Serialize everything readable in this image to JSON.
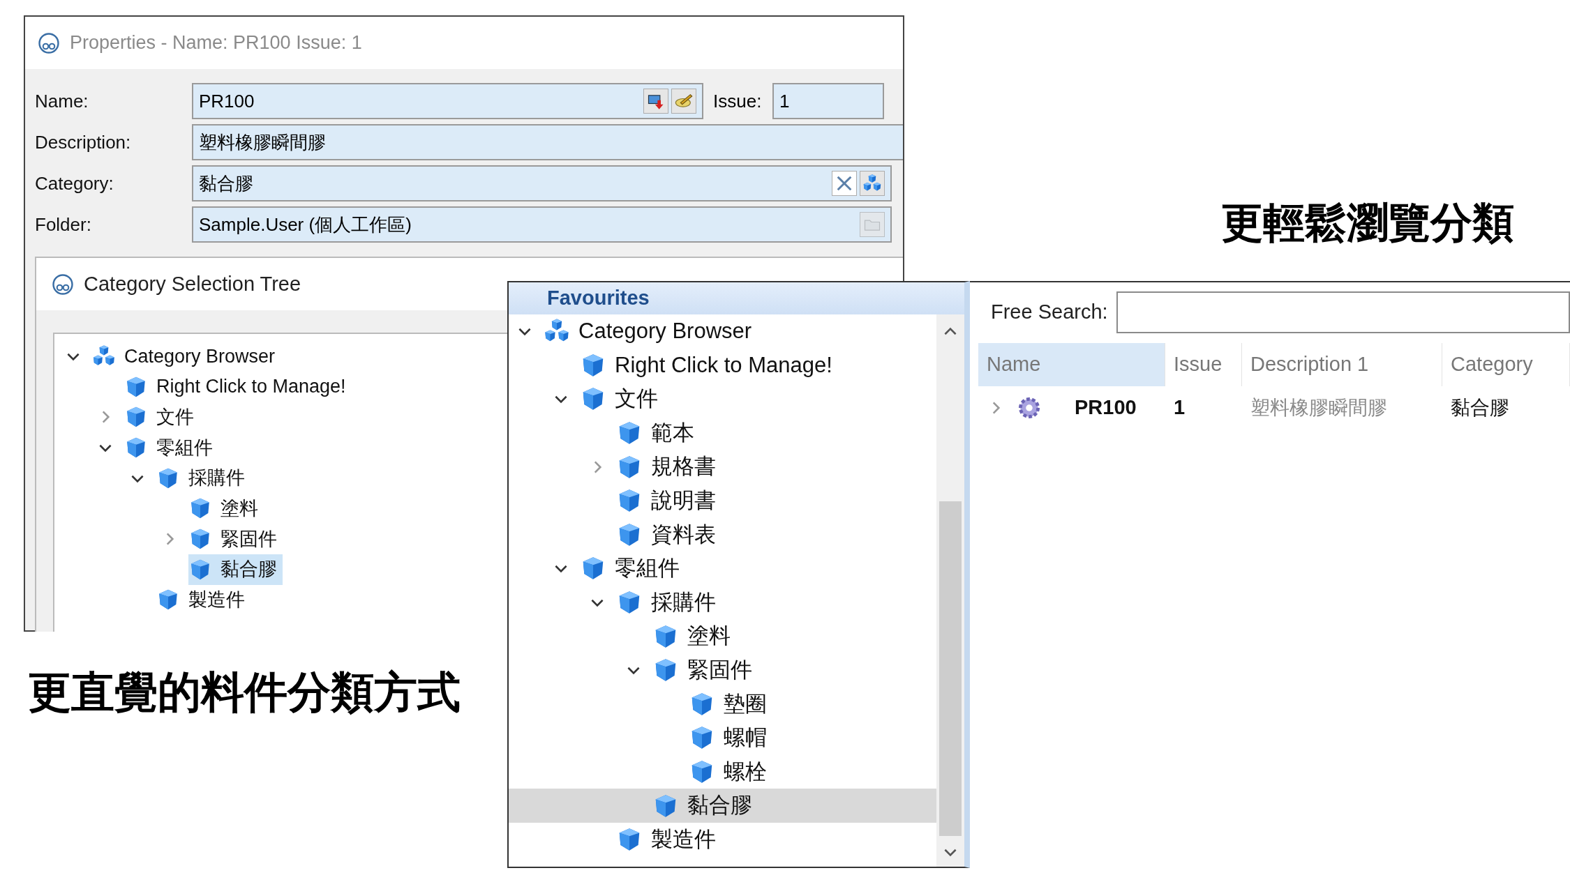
{
  "caption_right": "更輕鬆瀏覽分類",
  "properties_window": {
    "title": "Properties - Name: PR100 Issue: 1",
    "name_label": "Name:",
    "name_value": "PR100",
    "issue_label": "Issue:",
    "issue_value": "1",
    "description_label": "Description:",
    "description_value": "塑料橡膠瞬間膠",
    "category_label": "Category:",
    "category_value": "黏合膠",
    "folder_label": "Folder:",
    "folder_value": "Sample.User (個人工作區)"
  },
  "category_tree_window": {
    "title": "Category Selection Tree",
    "tree": [
      {
        "label": "Category Browser",
        "expanded": true,
        "selected": false,
        "children": [
          {
            "label": "Right Click to Manage!",
            "selected": false
          },
          {
            "label": "文件",
            "expanded": false,
            "selected": false
          },
          {
            "label": "零組件",
            "expanded": true,
            "selected": false,
            "children": [
              {
                "label": "採購件",
                "expanded": true,
                "selected": false,
                "children": [
                  {
                    "label": "塗料",
                    "selected": false
                  },
                  {
                    "label": "緊固件",
                    "expanded": false,
                    "selected": false
                  },
                  {
                    "label": "黏合膠",
                    "selected": true
                  }
                ]
              },
              {
                "label": "製造件",
                "selected": false
              }
            ]
          }
        ]
      }
    ]
  },
  "favourites_panel": {
    "header": "Favourites",
    "tree": [
      {
        "label": "Category Browser",
        "expanded": true,
        "selected": false,
        "children": [
          {
            "label": "Right Click to Manage!",
            "selected": false
          },
          {
            "label": "文件",
            "expanded": true,
            "selected": false,
            "children": [
              {
                "label": "範本",
                "selected": false
              },
              {
                "label": "規格書",
                "expanded": false,
                "selected": false
              },
              {
                "label": "說明書",
                "selected": false
              },
              {
                "label": "資料表",
                "selected": false
              }
            ]
          },
          {
            "label": "零組件",
            "expanded": true,
            "selected": false,
            "children": [
              {
                "label": "採購件",
                "expanded": true,
                "selected": false,
                "children": [
                  {
                    "label": "塗料",
                    "selected": false
                  },
                  {
                    "label": "緊固件",
                    "expanded": true,
                    "selected": false,
                    "children": [
                      {
                        "label": "墊圈",
                        "selected": false
                      },
                      {
                        "label": "螺帽",
                        "selected": false
                      },
                      {
                        "label": "螺栓",
                        "selected": false
                      }
                    ]
                  },
                  {
                    "label": "黏合膠",
                    "selected": true
                  }
                ]
              },
              {
                "label": "製造件",
                "selected": false
              }
            ]
          }
        ]
      }
    ]
  },
  "search_panel": {
    "search_label": "Free Search:",
    "columns": [
      {
        "label": "Name",
        "selected": true
      },
      {
        "label": "Issue",
        "selected": false
      },
      {
        "label": "Description 1",
        "selected": false
      },
      {
        "label": "Category",
        "selected": false
      }
    ],
    "rows": [
      {
        "expanded": false,
        "name": "PR100",
        "issue": "1",
        "description": "塑料橡膠瞬間膠",
        "category": "黏合膠"
      }
    ]
  },
  "caption_left": "更直覺的料件分類方式"
}
